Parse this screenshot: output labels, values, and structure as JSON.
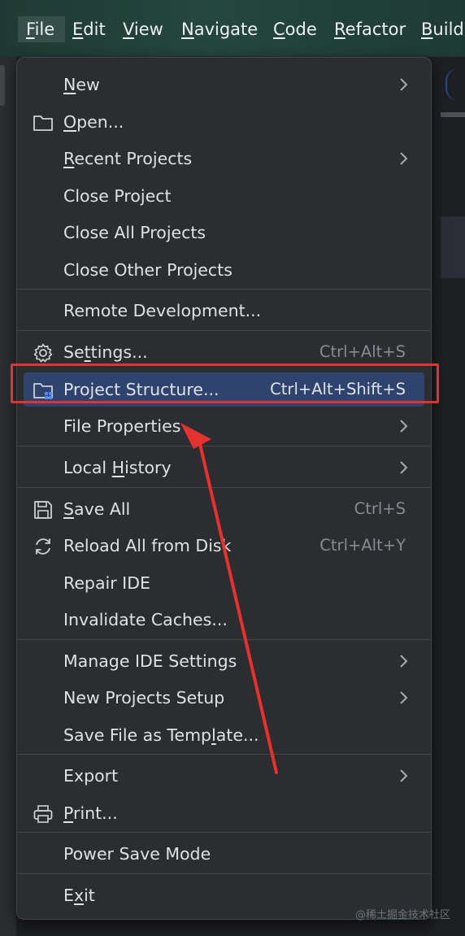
{
  "menubar": {
    "items": [
      {
        "pre": "",
        "u": "F",
        "post": "ile"
      },
      {
        "pre": "",
        "u": "E",
        "post": "dit"
      },
      {
        "pre": "",
        "u": "V",
        "post": "iew"
      },
      {
        "pre": "",
        "u": "N",
        "post": "avigate"
      },
      {
        "pre": "",
        "u": "C",
        "post": "ode"
      },
      {
        "pre": "",
        "u": "R",
        "post": "efactor"
      },
      {
        "pre": "",
        "u": "B",
        "post": "uild"
      }
    ],
    "active_index": 0
  },
  "file_menu": {
    "items": [
      {
        "pre": "",
        "u": "N",
        "post": "ew",
        "shortcut": "",
        "icon": "",
        "submenu": true
      },
      {
        "pre": "",
        "u": "O",
        "post": "pen...",
        "shortcut": "",
        "icon": "folder-icon",
        "submenu": false
      },
      {
        "pre": "",
        "u": "R",
        "post": "ecent Projects",
        "shortcut": "",
        "icon": "",
        "submenu": true
      },
      {
        "pre": "Close Project",
        "u": "",
        "post": "",
        "shortcut": "",
        "icon": "",
        "submenu": false
      },
      {
        "pre": "Close All Projects",
        "u": "",
        "post": "",
        "shortcut": "",
        "icon": "",
        "submenu": false
      },
      {
        "pre": "Close Other Projects",
        "u": "",
        "post": "",
        "shortcut": "",
        "icon": "",
        "submenu": false
      },
      {
        "pre": "Remote Development...",
        "u": "",
        "post": "",
        "shortcut": "",
        "icon": "",
        "submenu": false
      },
      {
        "pre": "Se",
        "u": "t",
        "post": "tings...",
        "shortcut": "Ctrl+Alt+S",
        "icon": "gear-icon",
        "submenu": false
      },
      {
        "pre": "Project Structure...",
        "u": "",
        "post": "",
        "shortcut": "Ctrl+Alt+Shift+S",
        "icon": "project-structure-icon",
        "submenu": false
      },
      {
        "pre": "File Properties",
        "u": "",
        "post": "",
        "shortcut": "",
        "icon": "",
        "submenu": true
      },
      {
        "pre": "Local ",
        "u": "H",
        "post": "istory",
        "shortcut": "",
        "icon": "",
        "submenu": true
      },
      {
        "pre": "",
        "u": "S",
        "post": "ave All",
        "shortcut": "Ctrl+S",
        "icon": "save-icon",
        "submenu": false
      },
      {
        "pre": "Reload All from Disk",
        "u": "",
        "post": "",
        "shortcut": "Ctrl+Alt+Y",
        "icon": "reload-icon",
        "submenu": false
      },
      {
        "pre": "Repair IDE",
        "u": "",
        "post": "",
        "shortcut": "",
        "icon": "",
        "submenu": false
      },
      {
        "pre": "Invalidate Caches...",
        "u": "",
        "post": "",
        "shortcut": "",
        "icon": "",
        "submenu": false
      },
      {
        "pre": "Manage IDE Settings",
        "u": "",
        "post": "",
        "shortcut": "",
        "icon": "",
        "submenu": true
      },
      {
        "pre": "New Projects Setup",
        "u": "",
        "post": "",
        "shortcut": "",
        "icon": "",
        "submenu": true
      },
      {
        "pre": "Save File as Temp",
        "u": "l",
        "post": "ate...",
        "shortcut": "",
        "icon": "",
        "submenu": false
      },
      {
        "pre": "Export",
        "u": "",
        "post": "",
        "shortcut": "",
        "icon": "",
        "submenu": true
      },
      {
        "pre": "",
        "u": "P",
        "post": "rint...",
        "shortcut": "",
        "icon": "printer-icon",
        "submenu": false
      },
      {
        "pre": "Power Save Mode",
        "u": "",
        "post": "",
        "shortcut": "",
        "icon": "",
        "submenu": false
      },
      {
        "pre": "E",
        "u": "x",
        "post": "it",
        "shortcut": "",
        "icon": "",
        "submenu": false
      }
    ],
    "selected_index": 8
  },
  "colors": {
    "menu_bg": "#2b2d30",
    "selection": "#2e436e",
    "annotation_red": "#e5312f",
    "shortcut_text": "#868a91"
  },
  "watermark": "@稀土掘金技术社区"
}
